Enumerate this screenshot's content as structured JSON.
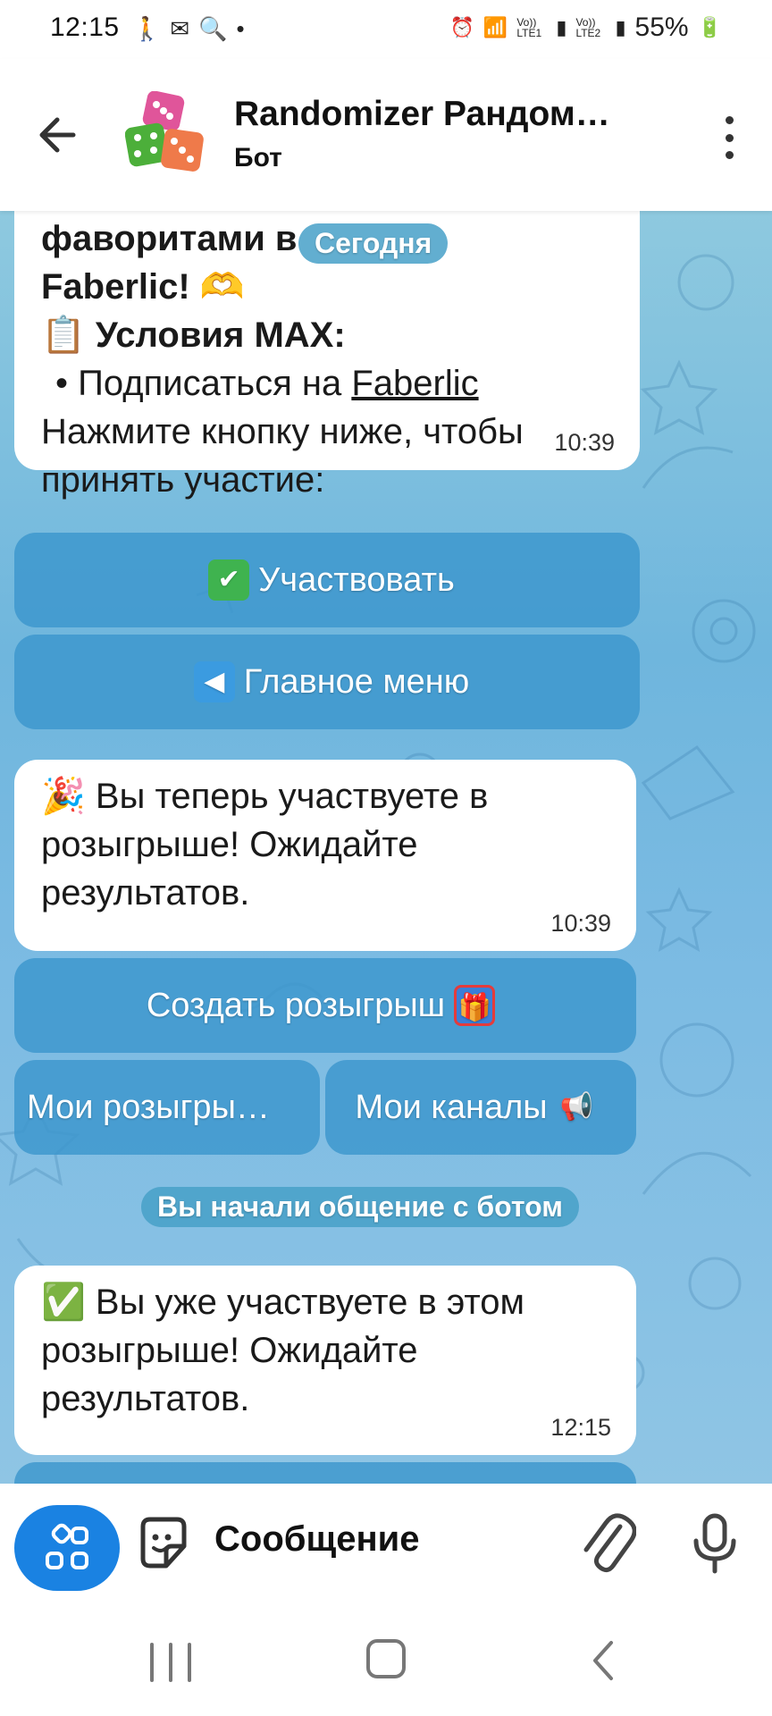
{
  "status_bar": {
    "time": "12:15",
    "left_icons": [
      "walking-icon",
      "mail-icon",
      "search-icon",
      "dot-icon"
    ],
    "sim1": "Vo)) LTE1",
    "sim2": "Vo)) LTE2",
    "battery": "55%"
  },
  "header": {
    "title": "Randomizer Рандом…",
    "subtitle": "Бот"
  },
  "messages": {
    "m1": {
      "line1": "фаворитами в",
      "line2": "Faberlic! 🫶",
      "conditions_label": "📋 Условия MAX:",
      "bullet": "• Подписаться на ",
      "link": "Faberlic",
      "line5": "Нажмите кнопку ниже, чтобы",
      "line6": "принять участие:",
      "time": "10:39"
    },
    "m2": {
      "line1": "🎉 Вы теперь участвуете в",
      "line2": "розыгрыше! Ожидайте",
      "line3": "результатов.",
      "time": "10:39"
    },
    "m3": {
      "line1": "✅ Вы уже участвуете в этом",
      "line2": "розыгрыше! Ожидайте",
      "line3": "результатов.",
      "time": "12:15"
    }
  },
  "date_pill": "Сегодня",
  "service_pill": "Вы начали общение с ботом",
  "buttons": {
    "participate": "Участвовать",
    "main_menu": "Главное меню",
    "create_giveaway": "Создать розыгрыш",
    "my_giveaways": "Мои розыгры…",
    "my_channels": "Мои каналы"
  },
  "input": {
    "placeholder": "Сообщение"
  },
  "colors": {
    "accent": "#1a82e2",
    "button_bg": "#3c96cd",
    "chat_bg": "#7cbbe3"
  }
}
